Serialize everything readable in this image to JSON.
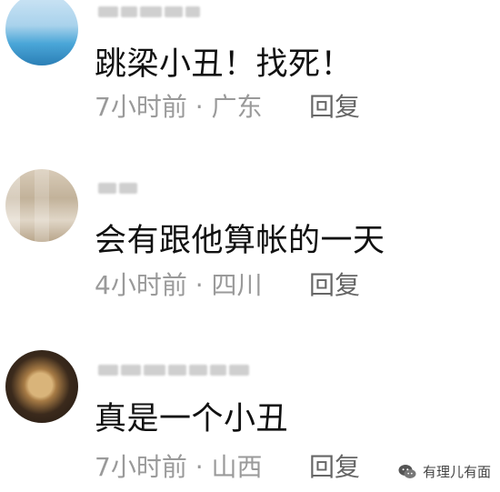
{
  "comments": [
    {
      "text": "跳梁小丑！找死！",
      "meta": "7小时前 · 广东",
      "reply": "回复"
    },
    {
      "text": "会有跟他算帐的一天",
      "meta": "4小时前 · 四川",
      "reply": "回复"
    },
    {
      "text": "真是一个小丑",
      "meta": "7小时前 · 山西",
      "reply": "回复"
    }
  ],
  "watermark": {
    "label": "有理儿有面",
    "icon": "wechat-icon"
  },
  "colors": {
    "background": "#ffffff",
    "text": "#111111",
    "meta": "#9a9a9a",
    "reply": "#666666"
  }
}
